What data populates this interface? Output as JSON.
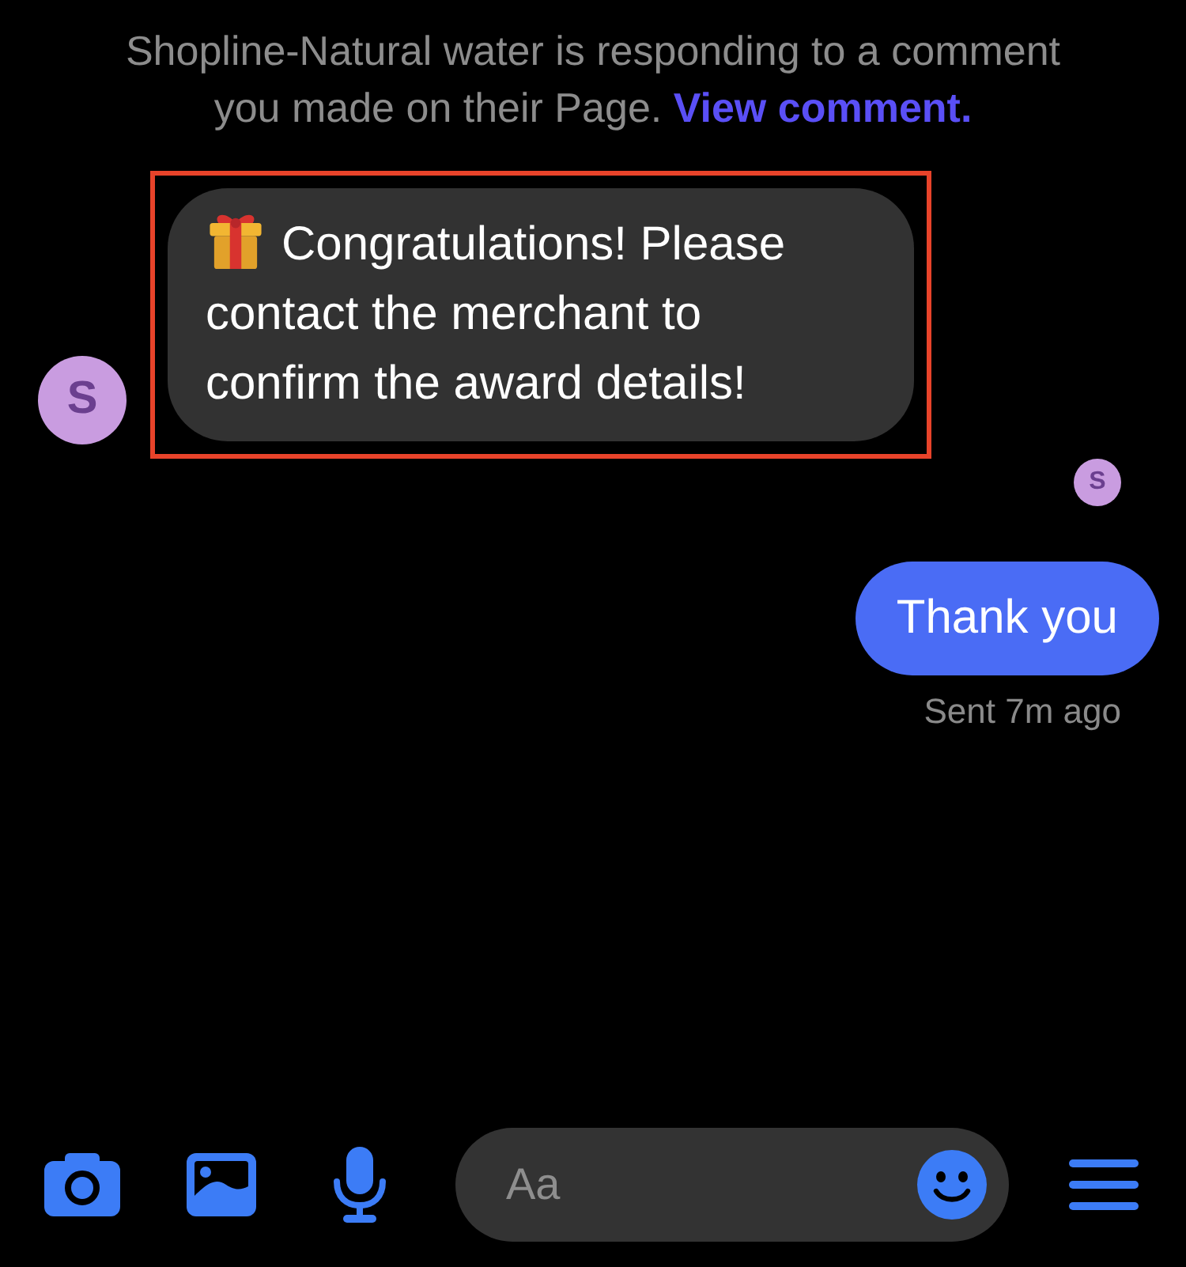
{
  "notice": {
    "text": "Shopline-Natural water is responding to a comment you made on their Page.",
    "link": "View comment."
  },
  "messages": [
    {
      "kind": "incoming",
      "sender_initial": "S",
      "text": "Congratulations! Please contact the merchant to confirm the award details!",
      "highlighted": true
    },
    {
      "kind": "outgoing",
      "text": "Thank you",
      "status": "Sent 7m ago"
    }
  ],
  "read_receipt": {
    "initial": "S"
  },
  "composer": {
    "placeholder": "Aa"
  }
}
